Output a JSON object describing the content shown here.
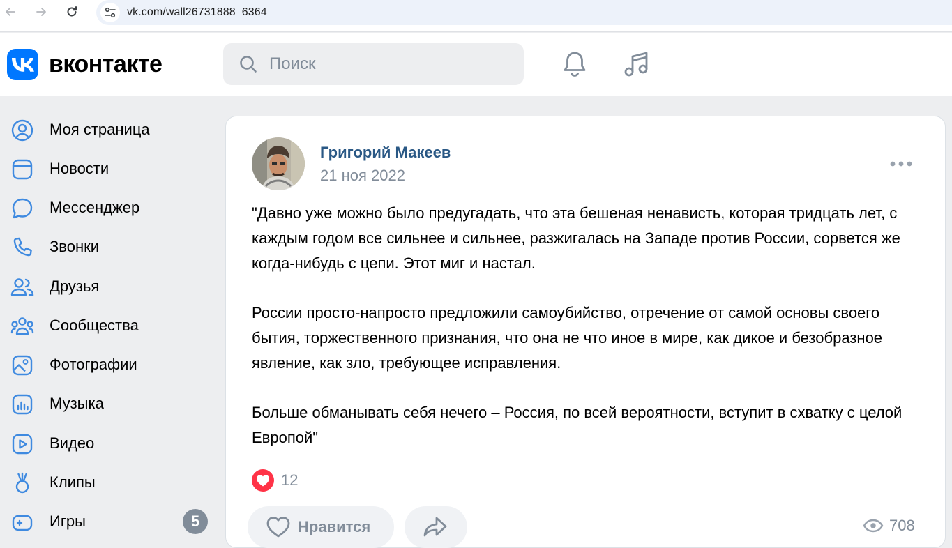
{
  "browser": {
    "url": "vk.com/wall26731888_6364"
  },
  "header": {
    "brand": "вконтакте",
    "search_placeholder": "Поиск"
  },
  "sidebar": {
    "items": [
      {
        "label": "Моя страница",
        "icon": "user-circle-icon"
      },
      {
        "label": "Новости",
        "icon": "newsfeed-icon"
      },
      {
        "label": "Мессенджер",
        "icon": "message-icon"
      },
      {
        "label": "Звонки",
        "icon": "phone-icon"
      },
      {
        "label": "Друзья",
        "icon": "friends-icon"
      },
      {
        "label": "Сообщества",
        "icon": "communities-icon"
      },
      {
        "label": "Фотографии",
        "icon": "photo-icon"
      },
      {
        "label": "Музыка",
        "icon": "music-icon"
      },
      {
        "label": "Видео",
        "icon": "video-icon"
      },
      {
        "label": "Клипы",
        "icon": "clips-icon"
      },
      {
        "label": "Игры",
        "icon": "games-icon",
        "badge": "5"
      }
    ]
  },
  "post": {
    "author": "Григорий Макеев",
    "date": "21 ноя 2022",
    "paragraphs": [
      "\"Давно уже можно было предугадать, что эта бешеная ненависть, которая тридцать лет, с каждым годом все сильнее и сильнее, разжигалась на Западе против России, сорвется же когда-нибудь с цепи. Этот миг и настал.",
      "России просто-напросто предложили самоубийство, отречение от самой основы своего бытия, торжественного признания, что она не что иное в мире, как дикое и безобразное явление, как зло, требующее исправления.",
      "Больше обманывать себя нечего – Россия, по всей вероятности, вступит в схватку с целой Европой\""
    ],
    "reactions_count": "12",
    "like_label": "Нравится",
    "views_count": "708"
  },
  "colors": {
    "accent": "#0077ff",
    "link": "#2a5885",
    "secondary": "#818c99",
    "reaction": "#ff3347"
  }
}
